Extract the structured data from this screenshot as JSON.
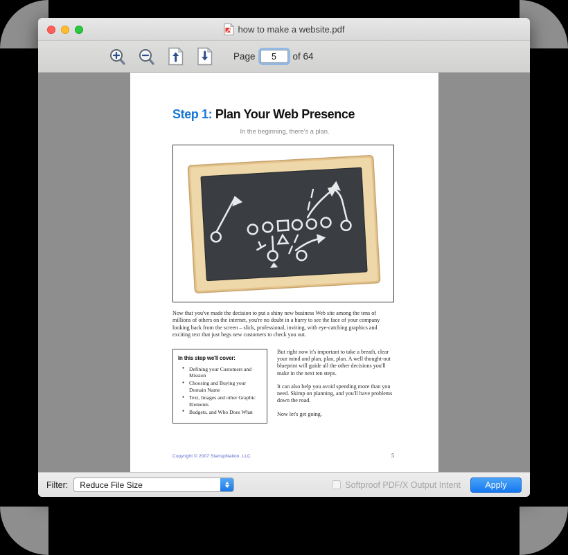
{
  "window": {
    "title": "how to make a website.pdf",
    "icon": "pdf-file-icon",
    "traffic_lights": {
      "close": "close-button",
      "minimize": "minimize-button",
      "zoom": "maximize-button"
    },
    "colors": {
      "close": "#ff5f57",
      "minimize": "#ffbd2e",
      "maximize": "#28c840",
      "accent_blue": "#1578ef",
      "desktop_gray": "#8e8e8e"
    }
  },
  "toolbar": {
    "zoom_in_label": "zoom-in",
    "zoom_out_label": "zoom-out",
    "page_up_label": "previous-page",
    "page_down_label": "next-page",
    "page_prefix": "Page",
    "page_value": "5",
    "page_suffix": "of 64",
    "total_pages": "64"
  },
  "document": {
    "heading_step": "Step 1:",
    "heading_rest": "Plan Your Web Presence",
    "subtitle": "In the beginning, there's a plan.",
    "figure_alt": "chalkboard-football-play-diagram",
    "paragraph": "Now that you've made the decision to put a shiny new business Web site among the tens of millions of others on the internet, you're no doubt in a hurry to see the face of your company looking back from the screen – slick, professional, inviting, with eye-catching graphics and exciting text that just begs new customers to check you out.",
    "callout_title": "In this step we'll cover:",
    "callout_items": [
      "Defining your Customers and Mission",
      "Choosing and Buying your Domain Name",
      "Text, Images and other Graphic Elements",
      "Budgets, and Who Does What"
    ],
    "right_column": [
      "But right now it's important to take a breath, clear your mind and plan, plan, plan. A well thought-out blueprint will guide all the other decisions you'll make in the next ten steps.",
      "It can also help you avoid spending more than you need. Skimp on planning, and you'll have problems down the road.",
      "Now let's get going."
    ],
    "footer_copyright": "Copyright © 2007 StartupNation, LLC",
    "footer_page_number": "5"
  },
  "bottom_bar": {
    "filter_label": "Filter:",
    "filter_value": "Reduce File Size",
    "filter_options": [
      "Reduce File Size"
    ],
    "softproof_label": "Softproof PDF/X Output Intent",
    "softproof_checked": false,
    "apply_label": "Apply"
  }
}
